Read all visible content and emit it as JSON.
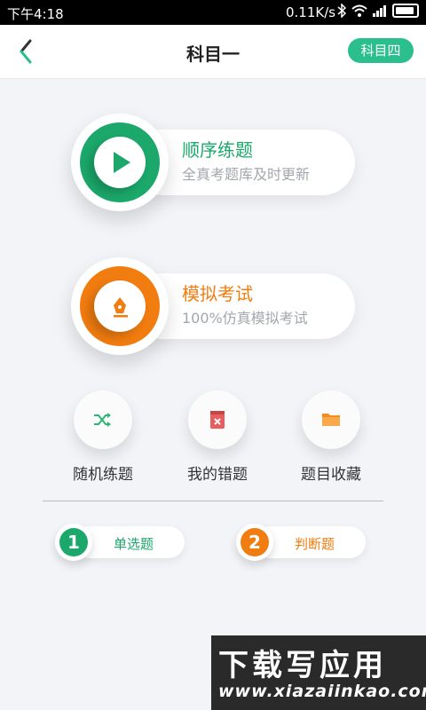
{
  "status_bar": {
    "time": "下午4:18",
    "net_speed": "0.11K/s"
  },
  "header": {
    "title": "科目一",
    "subject_switch": "科目四"
  },
  "main_cards": [
    {
      "title": "顺序练题",
      "subtitle": "全真考题库及时更新",
      "color": "#1ba86a",
      "icon": "play-icon"
    },
    {
      "title": "模拟考试",
      "subtitle": "100%仿真模拟考试",
      "color": "#f17c10",
      "icon": "pen-icon"
    }
  ],
  "tools": [
    {
      "label": "随机练题",
      "icon": "shuffle-icon",
      "color": "#2bb673"
    },
    {
      "label": "我的错题",
      "icon": "wrong-book-icon",
      "color": "#e85d5d"
    },
    {
      "label": "题目收藏",
      "icon": "folder-icon",
      "color": "#f58c1f"
    }
  ],
  "question_types": [
    {
      "number": "1",
      "label": "单选题",
      "color": "#1ba86a"
    },
    {
      "number": "2",
      "label": "判断题",
      "color": "#f17c10"
    }
  ],
  "watermark": {
    "title": "下载写应用",
    "url": "www.xiazaiinkao.com"
  }
}
